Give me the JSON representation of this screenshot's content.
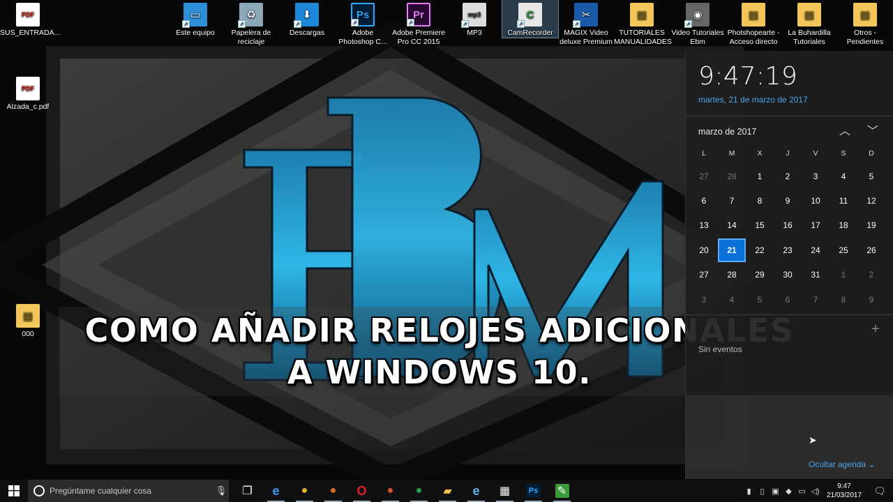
{
  "desktop": {
    "icons_top": [
      {
        "label": "SUS_ENTRADA...",
        "icon": "pdf-icon"
      },
      {
        "label": "Este equipo",
        "icon": "computer-icon"
      },
      {
        "label": "Papelera de reciclaje",
        "icon": "recycle-bin-icon"
      },
      {
        "label": "Descargas",
        "icon": "downloads-icon"
      },
      {
        "label": "Adobe Photoshop C...",
        "icon": "photoshop-icon"
      },
      {
        "label": "Adobe Premiere Pro CC 2015",
        "icon": "premiere-icon"
      },
      {
        "label": "MP3",
        "icon": "mp3-icon"
      },
      {
        "label": "CamRecorder",
        "icon": "camtasia-icon"
      },
      {
        "label": "MAGIX Video deluxe Premium",
        "icon": "magix-icon"
      },
      {
        "label": "TUTORIALES MANUALIDADES",
        "icon": "folder-icon"
      },
      {
        "label": "Video Tutoriales Ebm",
        "icon": "video-camera-icon"
      },
      {
        "label": "Photshopearte - Acceso directo",
        "icon": "folder-icon"
      },
      {
        "label": "La Buhardilla Tutoriales",
        "icon": "folder-icon"
      },
      {
        "label": "Otros - Pendientes",
        "icon": "folder-icon"
      }
    ],
    "icons_left": [
      {
        "label": "Alzada_c.pdf",
        "icon": "pdf-icon"
      },
      {
        "label": "000",
        "icon": "folder-icon"
      }
    ],
    "pdf_badge": "PDF",
    "ps_badge": "Ps",
    "pr_badge": "Pr",
    "mp3_badge": "mp3",
    "cam_badge": "C"
  },
  "caption": {
    "line1": "COMO AÑADIR RELOJES ADICIONALES",
    "line2": "A WINDOWS 10."
  },
  "flyout": {
    "time": "9:47:19",
    "date": "martes, 21 de marzo de 2017",
    "month": "marzo de 2017",
    "weekdays": [
      "L",
      "M",
      "X",
      "J",
      "V",
      "S",
      "D"
    ],
    "weeks": [
      [
        {
          "d": "27",
          "o": true
        },
        {
          "d": "28",
          "o": true
        },
        {
          "d": "1"
        },
        {
          "d": "2"
        },
        {
          "d": "3"
        },
        {
          "d": "4"
        },
        {
          "d": "5"
        }
      ],
      [
        {
          "d": "6"
        },
        {
          "d": "7"
        },
        {
          "d": "8"
        },
        {
          "d": "9"
        },
        {
          "d": "10"
        },
        {
          "d": "11"
        },
        {
          "d": "12"
        }
      ],
      [
        {
          "d": "13"
        },
        {
          "d": "14"
        },
        {
          "d": "15"
        },
        {
          "d": "16"
        },
        {
          "d": "17"
        },
        {
          "d": "18"
        },
        {
          "d": "19"
        }
      ],
      [
        {
          "d": "20"
        },
        {
          "d": "21",
          "t": true
        },
        {
          "d": "22"
        },
        {
          "d": "23"
        },
        {
          "d": "24"
        },
        {
          "d": "25"
        },
        {
          "d": "26"
        }
      ],
      [
        {
          "d": "27"
        },
        {
          "d": "28"
        },
        {
          "d": "29"
        },
        {
          "d": "30"
        },
        {
          "d": "31"
        },
        {
          "d": "1",
          "o": true
        },
        {
          "d": "2",
          "o": true
        }
      ],
      [
        {
          "d": "3",
          "o": true
        },
        {
          "d": "4",
          "o": true
        },
        {
          "d": "5",
          "o": true
        },
        {
          "d": "6",
          "o": true
        },
        {
          "d": "7",
          "o": true
        },
        {
          "d": "8",
          "o": true
        },
        {
          "d": "9",
          "o": true
        }
      ]
    ],
    "agenda_empty": "Sin eventos",
    "hide_agenda": "Ocultar agenda",
    "add_symbol": "+",
    "prev_symbol": "︿",
    "next_symbol": "﹀"
  },
  "taskbar": {
    "search_placeholder": "Pregúntame cualquier cosa",
    "apps": [
      {
        "name": "task-view-icon",
        "glyph": "❐",
        "color": "#ffffff",
        "bg": "transparent"
      },
      {
        "name": "edge-icon",
        "glyph": "e",
        "color": "#3b9cf0",
        "bg": "transparent"
      },
      {
        "name": "chrome-icon",
        "glyph": "●",
        "color": "#e7b21c",
        "bg": "transparent"
      },
      {
        "name": "firefox-icon",
        "glyph": "●",
        "color": "#e46b1e",
        "bg": "transparent"
      },
      {
        "name": "opera-icon",
        "glyph": "O",
        "color": "#e2202c",
        "bg": "transparent"
      },
      {
        "name": "firefox-dev-icon",
        "glyph": "●",
        "color": "#d9532a",
        "bg": "transparent"
      },
      {
        "name": "globe-icon",
        "glyph": "●",
        "color": "#2fa04a",
        "bg": "transparent"
      },
      {
        "name": "file-explorer-icon",
        "glyph": "▰",
        "color": "#f1c24a",
        "bg": "transparent"
      },
      {
        "name": "ie-icon",
        "glyph": "e",
        "color": "#5fb3ea",
        "bg": "transparent"
      },
      {
        "name": "store-icon",
        "glyph": "▦",
        "color": "#ffffff",
        "bg": "transparent"
      },
      {
        "name": "photoshop-icon",
        "glyph": "Ps",
        "color": "#31a8ff",
        "bg": "#001e36"
      },
      {
        "name": "camtasia-icon",
        "glyph": "✎",
        "color": "#ffffff",
        "bg": "#3a9a3a"
      }
    ],
    "tray_icons": [
      "▮",
      "▯",
      "▣",
      "◆",
      "▭",
      "◁)"
    ],
    "clock_time": "9:47",
    "clock_date": "21/03/2017"
  }
}
